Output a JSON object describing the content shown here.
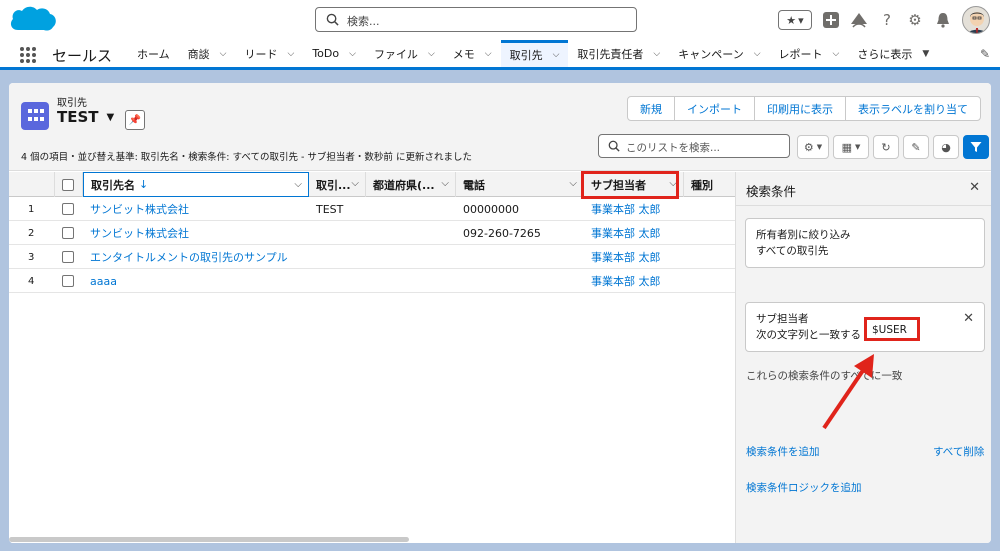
{
  "global_search": {
    "placeholder": "検索..."
  },
  "app": {
    "name": "セールス"
  },
  "nav": {
    "items": [
      {
        "label": "ホーム",
        "has_menu": false
      },
      {
        "label": "商談",
        "has_menu": true
      },
      {
        "label": "リード",
        "has_menu": true
      },
      {
        "label": "ToDo",
        "has_menu": true
      },
      {
        "label": "ファイル",
        "has_menu": true
      },
      {
        "label": "メモ",
        "has_menu": true
      },
      {
        "label": "取引先",
        "has_menu": true,
        "active": true
      },
      {
        "label": "取引先責任者",
        "has_menu": true
      },
      {
        "label": "キャンペーン",
        "has_menu": true
      },
      {
        "label": "レポート",
        "has_menu": true
      },
      {
        "label": "さらに表示",
        "has_menu": true
      }
    ]
  },
  "header": {
    "object_label": "取引先",
    "list_name": "TEST",
    "buttons": [
      "新規",
      "インポート",
      "印刷用に表示",
      "表示ラベルを割り当て"
    ],
    "meta": "4 個の項目・並び替え基準: 取引先名・検索条件: すべての取引先 - サブ担当者・数秒前 に更新されました",
    "list_search_placeholder": "このリストを検索..."
  },
  "table": {
    "columns": [
      "取引先名",
      "取引...",
      "都道府県(...",
      "電話",
      "サブ担当者",
      "種別"
    ],
    "rows": [
      {
        "num": "1",
        "name": "サンビット株式会社",
        "type": "TEST",
        "pref": "",
        "phone": "00000000",
        "sub_owner": "事業本部 太郎"
      },
      {
        "num": "2",
        "name": "サンビット株式会社",
        "type": "",
        "pref": "",
        "phone": "092-260-7265",
        "sub_owner": "事業本部 太郎"
      },
      {
        "num": "3",
        "name": "エンタイトルメントの取引先のサンプル",
        "type": "",
        "pref": "",
        "phone": "",
        "sub_owner": "事業本部 太郎"
      },
      {
        "num": "4",
        "name": "aaaa",
        "type": "",
        "pref": "",
        "phone": "",
        "sub_owner": "事業本部 太郎"
      }
    ]
  },
  "filter_panel": {
    "title": "検索条件",
    "owner_filter": {
      "label": "所有者別に絞り込み",
      "value": "すべての取引先"
    },
    "match_label": "これらの検索条件のすべてに一致",
    "condition": {
      "field": "サブ担当者",
      "operator": "次の文字列と一致する",
      "value": "$USER"
    },
    "add_filter": "検索条件を追加",
    "remove_all": "すべて削除",
    "add_logic": "検索条件ロジックを追加"
  },
  "colors": {
    "accent": "#0176d3",
    "highlight": "#e0241b",
    "object_icon": "#5a67dd"
  }
}
